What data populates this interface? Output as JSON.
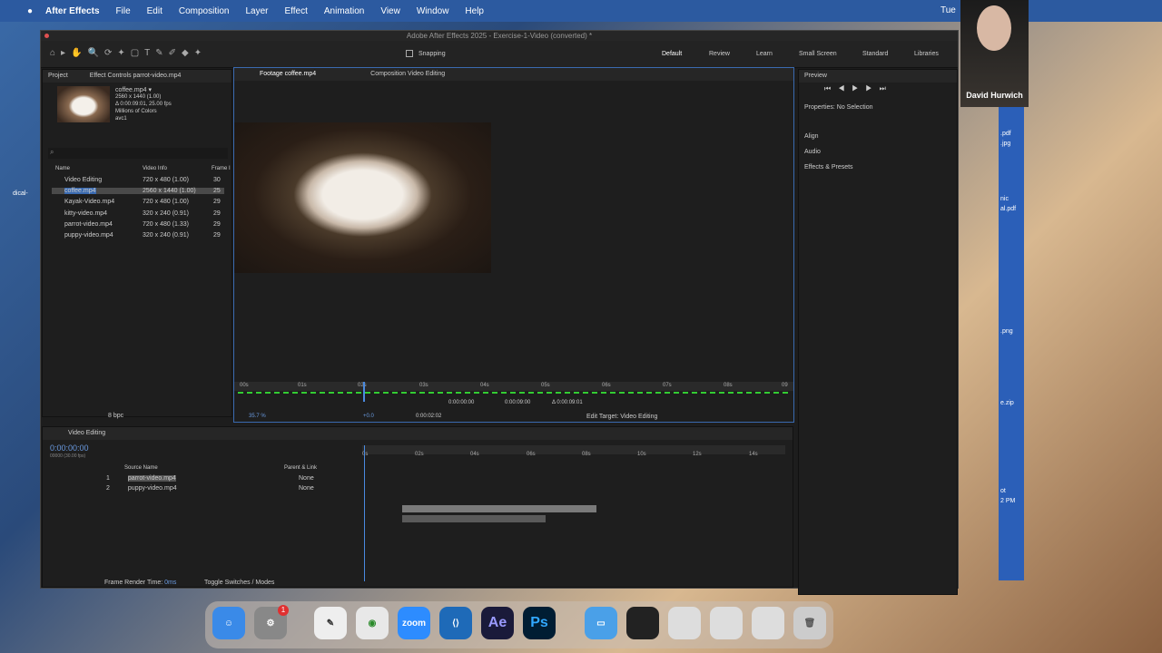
{
  "menubar": {
    "apple": "",
    "app": "After Effects",
    "items": [
      "File",
      "Edit",
      "Composition",
      "Layer",
      "Effect",
      "Animation",
      "View",
      "Window",
      "Help"
    ],
    "clock": "Tue"
  },
  "window": {
    "title": "Adobe After Effects 2025 - Exercise-1-Video (converted) *"
  },
  "toolbar": {
    "snapping": "Snapping",
    "workspaces": [
      "Default",
      "Review",
      "Learn",
      "Small Screen",
      "Standard",
      "Libraries"
    ]
  },
  "project": {
    "tab": "Project",
    "tab2": "Effect Controls parrot-video.mp4",
    "thumb_name": "coffee.mp4 ▾",
    "thumb_info": [
      "2560 x 1440 (1.00)",
      "Δ 0:00:09:01, 25.00 fps",
      "Millions of Colors",
      "avc1"
    ],
    "search_placeholder": "",
    "col_name": "Name",
    "col_info": "Video Info",
    "col_frame": "Frame I",
    "items": [
      {
        "name": "Video Editing",
        "info": "720 x 480 (1.00)",
        "fr": "30"
      },
      {
        "name": "coffee.mp4",
        "info": "2560 x 1440 (1.00)",
        "fr": "25"
      },
      {
        "name": "Kayak-Video.mp4",
        "info": "720 x 480 (1.00)",
        "fr": "29"
      },
      {
        "name": "kitty-video.mp4",
        "info": "320 x 240 (0.91)",
        "fr": "29"
      },
      {
        "name": "parrot-video.mp4",
        "info": "720 x 480 (1.33)",
        "fr": "29"
      },
      {
        "name": "puppy-video.mp4",
        "info": "320 x 240 (0.91)",
        "fr": "29"
      }
    ],
    "bpc": "8 bpc"
  },
  "footage": {
    "tab1": "Footage coffee.mp4",
    "tab2": "Composition Video Editing",
    "ruler": [
      "00s",
      "01s",
      "02s",
      "03s",
      "04s",
      "05s",
      "06s",
      "07s",
      "08s",
      "09"
    ],
    "in": "0:00:00:00",
    "out": "0:00:09:00",
    "dur": "Δ 0:00:09:01",
    "zoom": "35.7 %",
    "time": "0:00:02:02",
    "offset": "+0.0",
    "edit_target": "Edit Target: Video Editing"
  },
  "preview": {
    "tab": "Preview",
    "properties": "Properties: No Selection",
    "sections": [
      "Align",
      "Audio",
      "Effects & Presets"
    ]
  },
  "timeline": {
    "tab": "Video Editing",
    "timecode": "0:00:00:00",
    "timecode_sub": "00000 (30.00 fps)",
    "col_source": "Source Name",
    "col_parent": "Parent & Link",
    "ruler": [
      "0s",
      "02s",
      "04s",
      "06s",
      "08s",
      "10s",
      "12s",
      "14s"
    ],
    "layers": [
      {
        "num": "1",
        "name": "parrot-video.mp4",
        "parent": "None"
      },
      {
        "num": "2",
        "name": "puppy-video.mp4",
        "parent": "None"
      }
    ],
    "frame_render": "Frame Render Time:",
    "frame_render_val": "0ms",
    "toggle": "Toggle Switches / Modes"
  },
  "video_call": {
    "name": "David Hurwich"
  },
  "desktop_files": [
    ".pdf",
    ".jpg",
    "nic",
    "al.pdf",
    ".png",
    "e.zip",
    "ot",
    "2 PM",
    "dical-"
  ],
  "dock": [
    "Finder",
    "Settings",
    "Pages",
    "Chrome",
    "Zoom",
    "VS Code",
    "Ae",
    "Ps",
    "Folder"
  ],
  "badge": "1"
}
